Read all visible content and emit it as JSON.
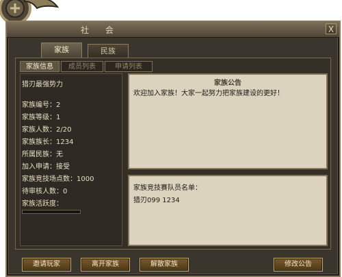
{
  "window": {
    "title": "社 会",
    "close_label": "X"
  },
  "main_tabs": [
    {
      "label": "家族"
    },
    {
      "label": "民族"
    }
  ],
  "sub_tabs": [
    {
      "label": "家族信息"
    },
    {
      "label": "成员列表"
    },
    {
      "label": "申请列表"
    }
  ],
  "family_info": {
    "name": "猎刃最强势力",
    "lines": [
      "家族编号：2",
      "家族等级：1",
      "家族人数：2/20",
      "家族族长：1234",
      "所属民族：无",
      "加入申请：接受",
      "家族竞技场点数：1000",
      "待审核人数：0",
      "家族活跃度："
    ],
    "activity_level": 0
  },
  "notice": {
    "title": "家族公告",
    "text": "欢迎加入家族！大家一起努力把家族建设的更好！"
  },
  "arena_roster": {
    "title": "家族竞技赛队员名单：",
    "members": [
      "猎刃099  1234"
    ]
  },
  "buttons": {
    "invite": "邀请玩家",
    "leave": "离开家族",
    "disband": "解散家族",
    "edit_notice": "修改公告"
  }
}
